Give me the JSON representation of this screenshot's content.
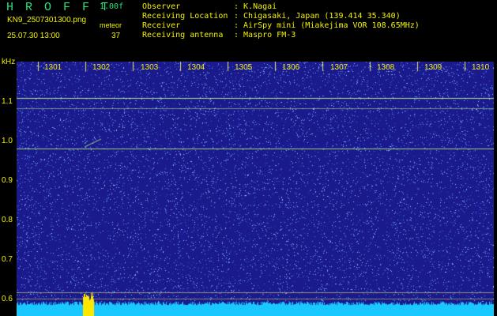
{
  "header": {
    "app_title": "H R O F F T",
    "version": "1.00f",
    "filename": "KN9_2507301300.png",
    "datetime": "25.07.30 13:00",
    "meteor_label": "meteor",
    "meteor_count": "37"
  },
  "info": [
    {
      "label": "Observer",
      "value": ": K.Nagai"
    },
    {
      "label": "Receiving Location",
      "value": ": Chigasaki, Japan (139.414 35.340)"
    },
    {
      "label": "Receiver",
      "value": ": AirSpy mini (Miakejima VOR 108.65MHz)"
    },
    {
      "label": "Receiving antenna",
      "value": ": Maspro FM-3"
    }
  ],
  "axis": {
    "y_unit": "kHz",
    "y_ticks": [
      "1.1",
      "1.0",
      "0.9",
      "0.8",
      "0.7",
      "0.6"
    ],
    "x_ticks": [
      "1301",
      "1302",
      "1303",
      "1304",
      "1305",
      "1306",
      "1307",
      "1308",
      "1309",
      "1310"
    ]
  },
  "colors": {
    "background": "#1a1a8c",
    "noise": "#4a7cff",
    "signal_line": "#b9f27a",
    "grid": "#e8e860",
    "baseline": "#18c8ff",
    "burst": "#ffe800",
    "label": "#f2f200",
    "title": "#2fe07a"
  }
}
